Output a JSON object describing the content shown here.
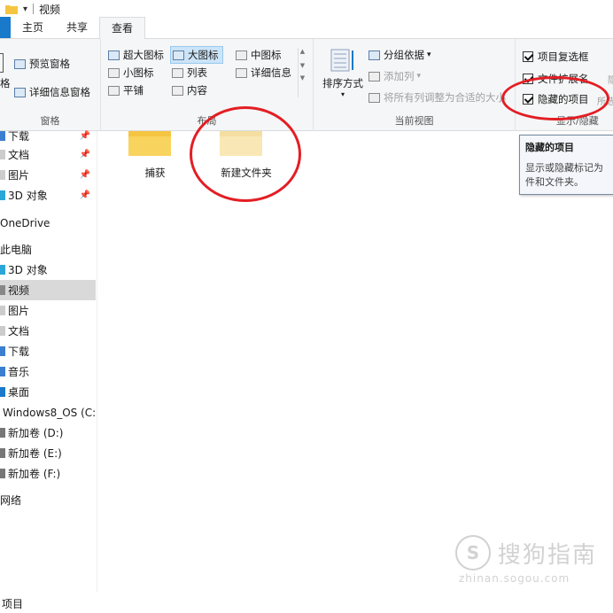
{
  "window": {
    "title": "视频"
  },
  "tabs": [
    {
      "label": "主页"
    },
    {
      "label": "共享"
    },
    {
      "label": "查看"
    }
  ],
  "ribbon": {
    "panes": {
      "preview": "预览窗格",
      "details": "详细信息窗格",
      "partial_label": "格",
      "label": "窗格"
    },
    "layout": {
      "items": [
        "超大图标",
        "大图标",
        "中图标",
        "小图标",
        "列表",
        "详细信息",
        "平铺",
        "内容"
      ],
      "selected": "大图标",
      "label": "布局"
    },
    "current_view": {
      "sort": "排序方式",
      "group_by": "分组依据",
      "add_column": "添加列",
      "fit_columns": "将所有列调整为合适的大小",
      "label": "当前视图"
    },
    "show_hide": {
      "item_checkboxes": "项目复选框",
      "file_extensions": "文件扩展名",
      "hidden_items": "隐藏的项目",
      "hide_partial_1": "隐",
      "hide_partial_2": "所选",
      "label": "显示/隐藏",
      "item_checkboxes_checked": true,
      "file_extensions_checked": true,
      "hidden_items_checked": true
    }
  },
  "tooltip": {
    "title": "隐藏的项目",
    "body": "显示或隐藏标记为隐藏的文件和文件夹。",
    "body_line1": "显示或隐藏标记为",
    "body_line2": "件和文件夹。"
  },
  "nav": {
    "items": [
      {
        "label": "下载",
        "pinned": true
      },
      {
        "label": "文档",
        "pinned": true
      },
      {
        "label": "图片",
        "pinned": true
      },
      {
        "label": "3D 对象",
        "pinned": true
      },
      {
        "label": "OneDrive"
      },
      {
        "label": "此电脑"
      },
      {
        "label": "3D 对象"
      },
      {
        "label": "视频",
        "selected": true
      },
      {
        "label": "图片"
      },
      {
        "label": "文档"
      },
      {
        "label": "下载"
      },
      {
        "label": "音乐"
      },
      {
        "label": "桌面"
      },
      {
        "label": "Windows8_OS (C:)"
      },
      {
        "label": "新加卷 (D:)"
      },
      {
        "label": "新加卷 (E:)"
      },
      {
        "label": "新加卷 (F:)"
      },
      {
        "label": "网络"
      }
    ]
  },
  "folders": [
    {
      "name": "捕获",
      "hidden": false
    },
    {
      "name": "新建文件夹",
      "hidden": true
    }
  ],
  "status": {
    "text": "项目"
  },
  "watermark": {
    "logo": "S",
    "text": "搜狗指南",
    "url": "zhinan.sogou.com"
  },
  "colors": {
    "accent": "#1979ca",
    "selection": "#cce4f7",
    "annotation": "#e31e24",
    "folder": "#f5c542",
    "folder_hidden": "#f9e4a8"
  }
}
